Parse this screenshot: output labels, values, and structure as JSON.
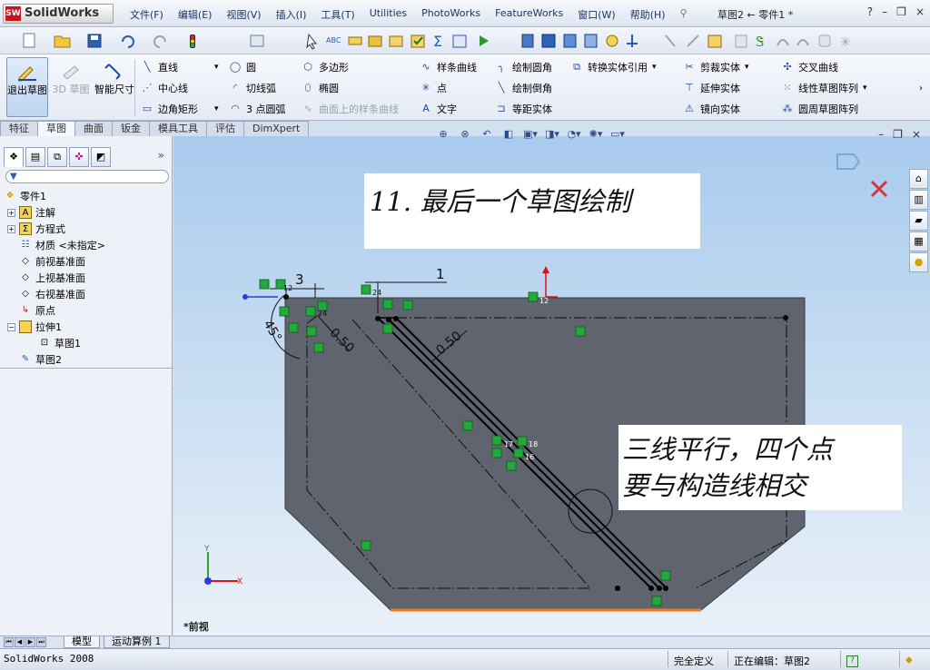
{
  "app": {
    "name": "SolidWorks",
    "status_app": "SolidWorks 2008"
  },
  "menu": [
    "文件(F)",
    "编辑(E)",
    "视图(V)",
    "插入(I)",
    "工具(T)",
    "Utilities",
    "PhotoWorks",
    "FeatureWorks",
    "窗口(W)",
    "帮助(H)"
  ],
  "window": {
    "title": "草图2 ← 零件1 *",
    "help": "?",
    "min": "–",
    "restore": "❐",
    "close": "×"
  },
  "ribbon": {
    "exit_sketch": "退出草图",
    "sketch3d": "3D 草图",
    "smart_dim": "智能尺寸",
    "col1": [
      "直线",
      "中心线",
      "边角矩形"
    ],
    "col2": [
      "圆",
      "切线弧",
      "3 点圆弧"
    ],
    "col3": [
      "多边形",
      "椭圆",
      "曲面上的样条曲线"
    ],
    "col4": [
      "样条曲线",
      "点",
      "文字"
    ],
    "col5": [
      "绘制圆角",
      "绘制倒角",
      "等距实体"
    ],
    "col6": [
      "转换实体引用"
    ],
    "col7": [
      "剪裁实体",
      "延伸实体",
      "镜向实体"
    ],
    "col8": [
      "交叉曲线",
      "线性草图阵列",
      "圆周草图阵列"
    ]
  },
  "cmd_tabs": [
    "特征",
    "草图",
    "曲面",
    "钣金",
    "模具工具",
    "评估",
    "DimXpert"
  ],
  "cmd_tab_active": 1,
  "tree": {
    "root": "零件1",
    "items": [
      "注解",
      "方程式",
      "材质 <未指定>",
      "前视基准面",
      "上视基准面",
      "右视基准面",
      "原点",
      "拉伸1",
      "草图1",
      "草图2"
    ]
  },
  "sketch": {
    "dims": {
      "d3": "3",
      "d1": "1",
      "d45": "45°",
      "d050a": "0.50",
      "d050b": "0.50"
    },
    "relations": {
      "r12a": "12",
      "r12b": "12",
      "r24a": "24",
      "r24b": "24",
      "r17": "17",
      "r18": "18",
      "r16": "16"
    }
  },
  "captions": {
    "c1": "11. 最后一个草图绘制",
    "c2_line1": "三线平行，四个点",
    "c2_line2": "要与构造线相交"
  },
  "view_label": "*前视",
  "axes": {
    "y": "Y",
    "x": "X"
  },
  "sheet_tabs": [
    "模型",
    "运动算例 1"
  ],
  "status": {
    "constraint": "完全定义",
    "editing": "正在编辑：草图2",
    "help_icon": "?"
  },
  "colors": {
    "body": "#5f6470",
    "sketch_line": "#000000",
    "relation_green": "#1fa33a",
    "highlight_edge": "#f07b1a",
    "dim_red": "#d11"
  }
}
